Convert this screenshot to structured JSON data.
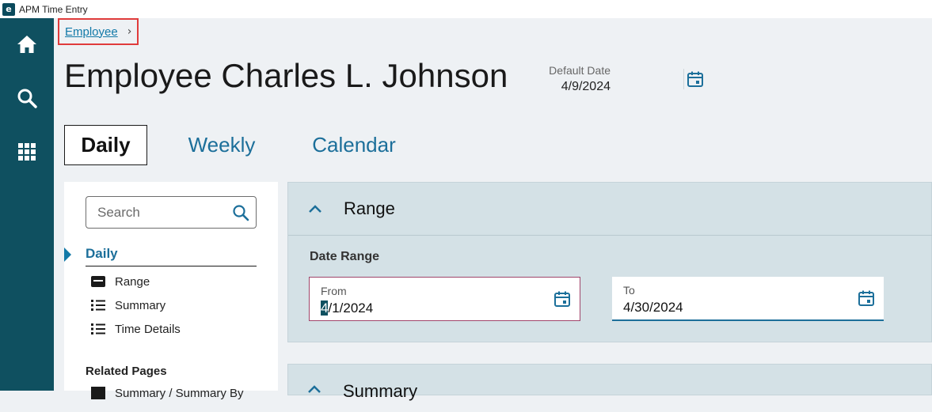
{
  "window": {
    "title": "APM Time Entry",
    "icon": "app-logo-icon"
  },
  "rail": {
    "items": [
      {
        "name": "home",
        "icon": "home-icon"
      },
      {
        "name": "search",
        "icon": "search-icon"
      },
      {
        "name": "apps",
        "icon": "grid-icon"
      }
    ]
  },
  "breadcrumb": {
    "link": "Employee",
    "separator": "›"
  },
  "page": {
    "title": "Employee Charles L. Johnson"
  },
  "default_date": {
    "label": "Default Date",
    "value": "4/9/2024",
    "icon": "calendar-icon"
  },
  "tabs": [
    {
      "label": "Daily",
      "active": true
    },
    {
      "label": "Weekly",
      "active": false
    },
    {
      "label": "Calendar",
      "active": false
    }
  ],
  "nav": {
    "search_placeholder": "Search",
    "heading": "Daily",
    "items": [
      {
        "label": "Range",
        "icon": "form-icon"
      },
      {
        "label": "Summary",
        "icon": "list-icon"
      },
      {
        "label": "Time Details",
        "icon": "list-icon"
      }
    ],
    "related_heading": "Related Pages",
    "related_items": [
      {
        "label": "Summary / Summary By",
        "icon": "page-icon"
      }
    ]
  },
  "range": {
    "title": "Range",
    "date_range_label": "Date Range",
    "from": {
      "label": "From",
      "value": "4/1/2024",
      "first_char": "4",
      "rest": "/1/2024"
    },
    "to": {
      "label": "To",
      "value": "4/30/2024"
    }
  },
  "summary": {
    "title": "Summary"
  },
  "colors": {
    "rail": "#0f5060",
    "accent": "#1c6f9a",
    "panel": "#d4e1e6",
    "focus_border": "#a0446a",
    "breadcrumb_highlight": "#e03b3b"
  }
}
